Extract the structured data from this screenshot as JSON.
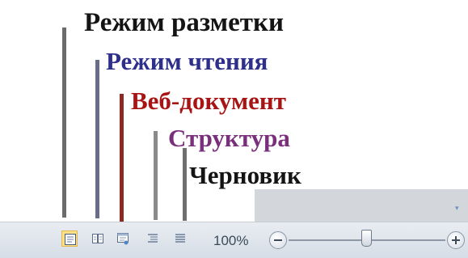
{
  "callouts": {
    "print_layout": "Режим разметки",
    "reading": "Режим чтения",
    "web_document": "Веб-документ",
    "outline": "Структура",
    "draft": "Черновик"
  },
  "callout_colors": {
    "print_layout": "#141414",
    "reading": "#2e2f8a",
    "web_document": "#a81414",
    "outline": "#7a2f7d",
    "draft": "#141414"
  },
  "status_bar": {
    "view_buttons": [
      {
        "name": "print-layout",
        "icon": "print-layout-icon",
        "active": true
      },
      {
        "name": "full-screen-reading",
        "icon": "full-screen-reading-icon",
        "active": false
      },
      {
        "name": "web-layout",
        "icon": "web-layout-icon",
        "active": false
      },
      {
        "name": "outline",
        "icon": "outline-icon",
        "active": false
      },
      {
        "name": "draft",
        "icon": "draft-icon",
        "active": false
      }
    ],
    "zoom": {
      "level": "100%",
      "minus_icon": "zoom-out-icon",
      "plus_icon": "zoom-in-icon",
      "slider_position": 0.5
    }
  },
  "colors": {
    "active_highlight": "#fbe28a",
    "status_bar": "#dfe4ea"
  }
}
